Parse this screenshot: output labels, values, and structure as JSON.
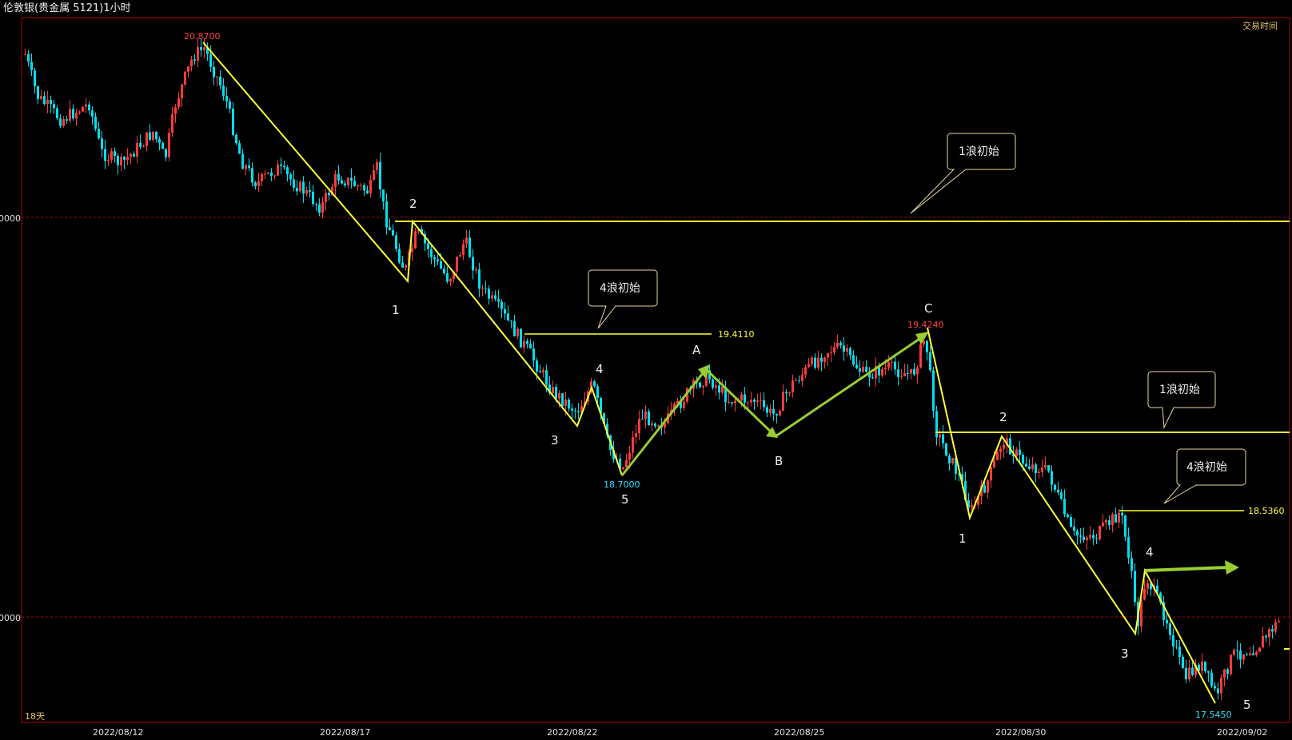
{
  "window": {
    "title": "伦敦银(贵金属 5121)1小时",
    "corner_label": "交易时间",
    "period_label": "18天"
  },
  "colors": {
    "up": "#ff3b3b",
    "down": "#00e0f0",
    "wave_line": "#ffff33",
    "arrow": "#9acd32",
    "frame": "#b00000",
    "high_label": "#ff4040",
    "low_label": "#33e0ff",
    "level_label": "#ffff33"
  },
  "chart_data": {
    "type": "candlestick",
    "x": [
      "2022/08/12",
      "2022/08/17",
      "2022/08/22",
      "2022/08/25",
      "2022/08/30",
      "2022/09/02"
    ],
    "ylim": [
      17.5,
      20.95
    ],
    "y_gridlines": [
      "0000",
      "0000"
    ],
    "marked_prices": {
      "first_high": "20.8700",
      "wave4_level_1": "19.4110",
      "first_low": "18.7000",
      "c_high": "19.4240",
      "wave4_level_2": "18.5360",
      "final_low": "17.5450"
    },
    "wave_labels": {
      "w1": "1",
      "w2": "2",
      "w3": "3",
      "w4": "4",
      "w5": "5",
      "a": "A",
      "b": "B",
      "c": "C",
      "v1": "1",
      "v2": "2",
      "v3": "3",
      "v4": "4",
      "v5": "5"
    },
    "annotations": {
      "callout_1": "1浪初始",
      "callout_2": "4浪初始",
      "callout_3": "1浪初始",
      "callout_4": "4浪初始"
    }
  }
}
